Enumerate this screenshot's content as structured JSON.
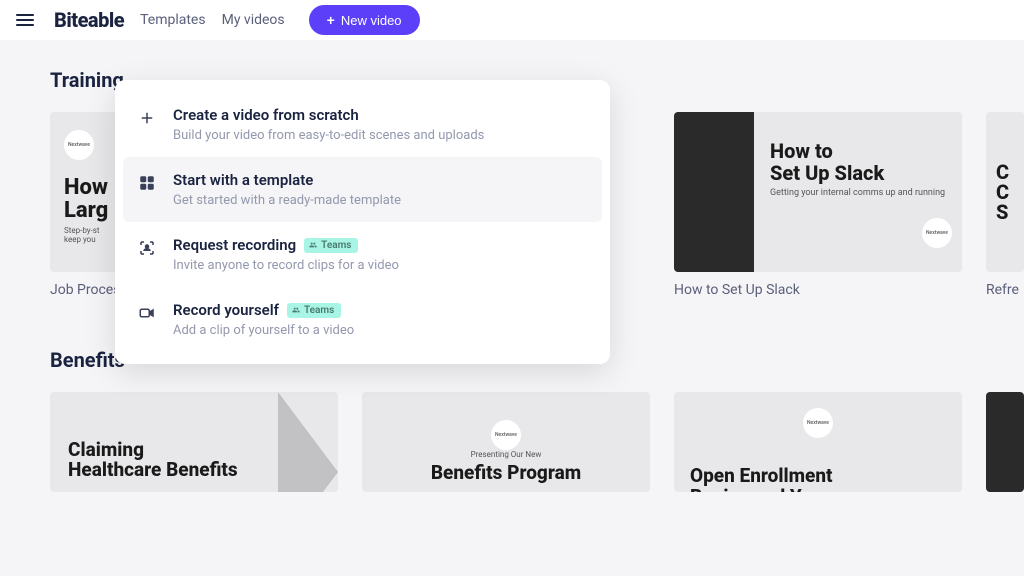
{
  "header": {
    "logo": "Biteable",
    "nav": {
      "templates": "Templates",
      "my_videos": "My videos"
    },
    "new_video": "New video"
  },
  "dropdown": {
    "items": [
      {
        "title": "Create a video from scratch",
        "sub": "Build your video from easy-to-edit scenes and uploads",
        "badge": null
      },
      {
        "title": "Start with a template",
        "sub": "Get started with a ready-made template",
        "badge": null
      },
      {
        "title": "Request recording",
        "sub": "Invite anyone to record clips for a video",
        "badge": "Teams"
      },
      {
        "title": "Record yourself",
        "sub": "Add a clip of yourself to a video",
        "badge": "Teams"
      }
    ]
  },
  "sections": {
    "training": {
      "title": "Training",
      "cards": [
        {
          "label": "Job Process",
          "title_a": "How",
          "title_b": "Larg",
          "sub_a": "Step-by-st",
          "sub_b": "keep you",
          "badge": "Nextwave"
        },
        {
          "label": "How to Set Up Slack",
          "title_a": "How to",
          "title_b": "Set Up Slack",
          "sub": "Getting your internal comms up and running",
          "badge": "Nextwave"
        },
        {
          "label": "Refre",
          "glyphs": [
            "C",
            "C",
            "S"
          ]
        }
      ]
    },
    "benefits": {
      "title": "Benefits",
      "cards": [
        {
          "title_a": "Claiming",
          "title_b": "Healthcare Benefits",
          "sub": ""
        },
        {
          "pre": "Presenting Our New",
          "title": "Benefits Program",
          "badge": "Nextwave"
        },
        {
          "title_a": "Open Enrollment",
          "title_b": "Begins and Your",
          "badge": "Nextwave"
        }
      ]
    }
  }
}
